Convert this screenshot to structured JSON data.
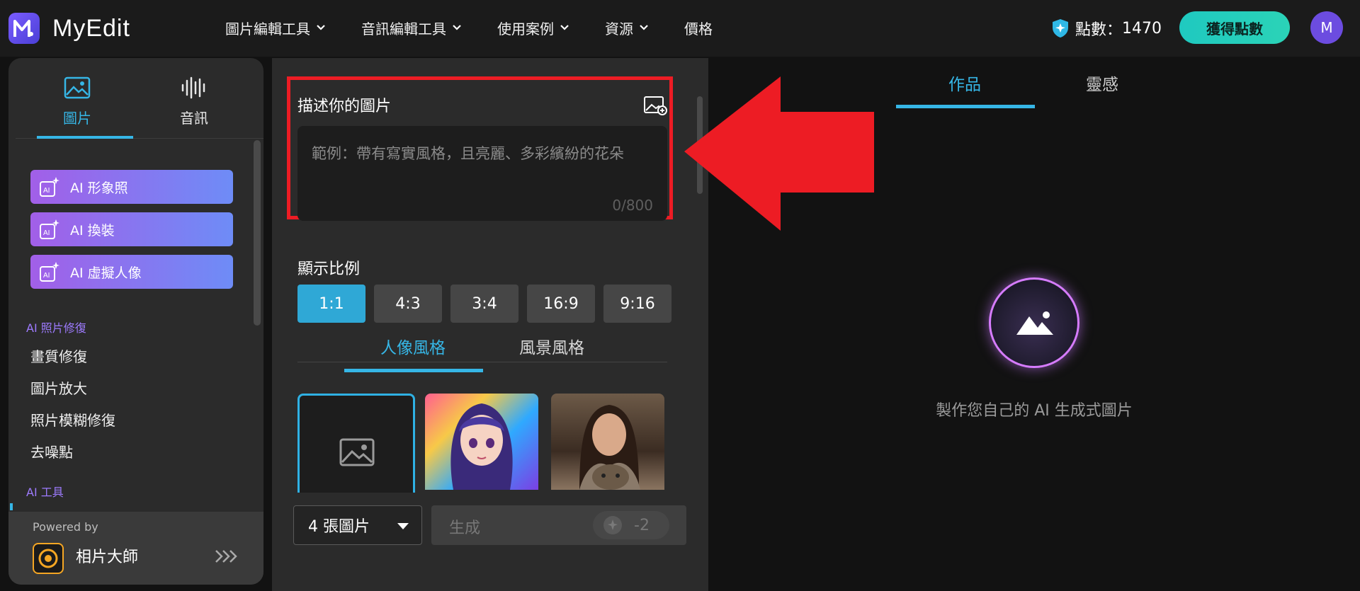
{
  "app": {
    "name": "MyEdit"
  },
  "nav": [
    {
      "label": "圖片編輯工具",
      "has_dropdown": true
    },
    {
      "label": "音訊編輯工具",
      "has_dropdown": true
    },
    {
      "label": "使用案例",
      "has_dropdown": true
    },
    {
      "label": "資源",
      "has_dropdown": true
    },
    {
      "label": "價格",
      "has_dropdown": false
    }
  ],
  "header": {
    "points_label": "點數：",
    "points_value": "1470",
    "get_points_label": "獲得點數",
    "avatar_initial": "M"
  },
  "sidebar": {
    "tabs": [
      {
        "label": "圖片",
        "icon": "image-icon",
        "active": true
      },
      {
        "label": "音訊",
        "icon": "waveform-icon",
        "active": false
      }
    ],
    "ai_buttons": [
      {
        "label": "AI 形象照",
        "icon": "ai-sparkle-icon"
      },
      {
        "label": "AI 換裝",
        "icon": "ai-sparkle-icon"
      },
      {
        "label": "AI 虛擬人像",
        "icon": "ai-sparkle-icon"
      }
    ],
    "section_photo_repair": "AI 照片修復",
    "links": [
      "畫質修復",
      "圖片放大",
      "照片模糊修復",
      "去噪點"
    ],
    "section_ai_tools": "AI 工具",
    "powered_by": "Powered by",
    "powered_name": "相片大師"
  },
  "panel": {
    "prompt_title": "描述你的圖片",
    "prompt_placeholder": "範例：帶有寫實風格，且亮麗、多彩繽紛的花朵",
    "prompt_count": "0/800",
    "ratio_title": "顯示比例",
    "ratios": [
      {
        "label": "1:1",
        "active": true
      },
      {
        "label": "4:3",
        "active": false
      },
      {
        "label": "3:4",
        "active": false
      },
      {
        "label": "16:9",
        "active": false
      },
      {
        "label": "9:16",
        "active": false
      }
    ],
    "style_tabs": [
      {
        "label": "人像風格",
        "active": true
      },
      {
        "label": "風景風格",
        "active": false
      }
    ],
    "quantity_value": "4 張圖片",
    "generate_label": "生成",
    "generate_cost": "-2"
  },
  "right": {
    "tabs": [
      {
        "label": "作品",
        "active": true
      },
      {
        "label": "靈感",
        "active": false
      }
    ],
    "empty_text": "製作您自己的 AI 生成式圖片"
  },
  "colors": {
    "accent": "#36b6e6",
    "highlight_red": "#ed1c24",
    "cta_green": "#1fc9c0",
    "ai_gradient_start": "#a25fe8",
    "ai_gradient_end": "#6e8cf7"
  }
}
